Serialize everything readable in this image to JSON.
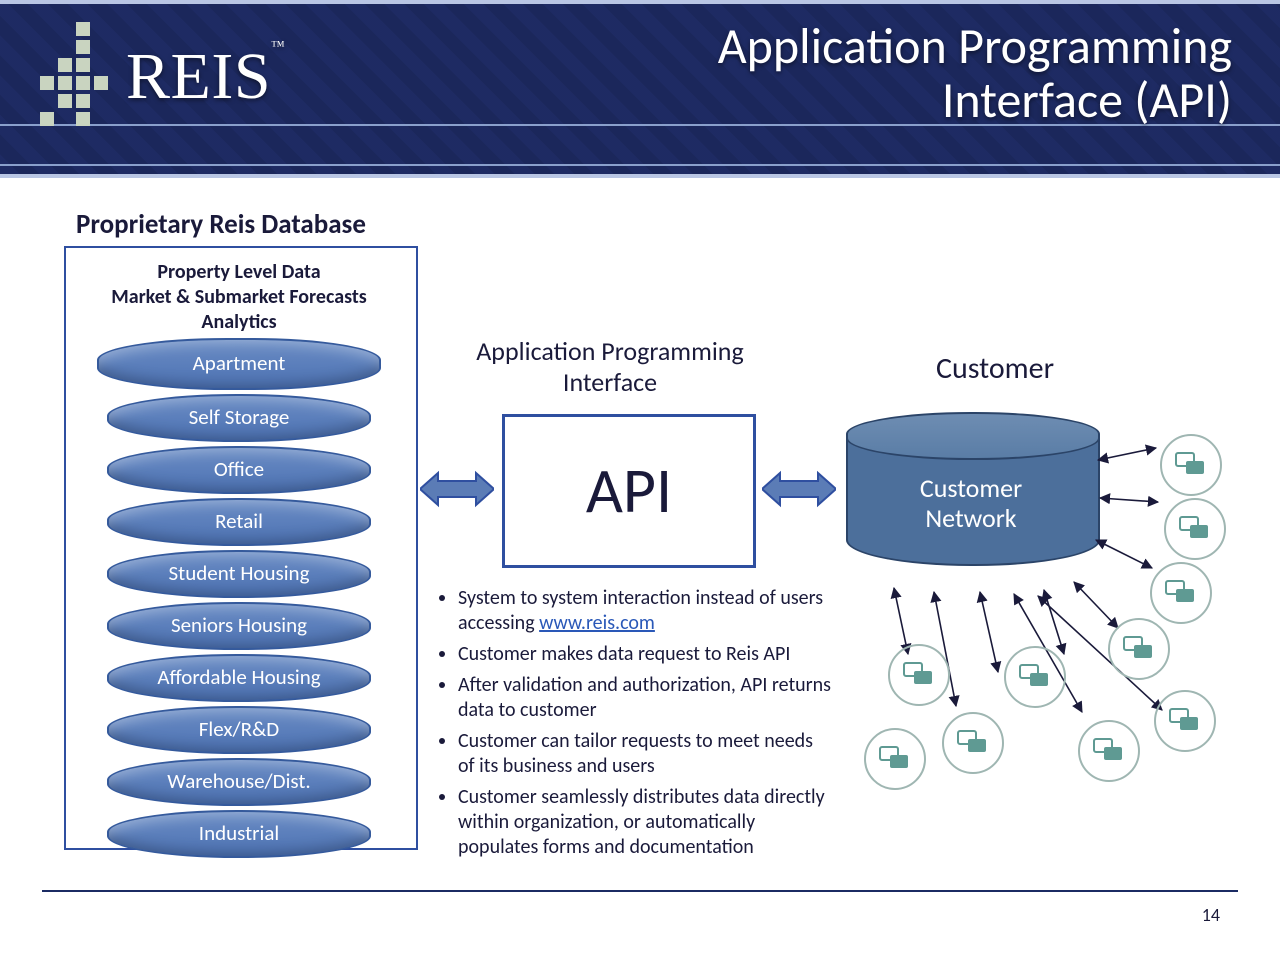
{
  "header": {
    "brand": "REIS",
    "tm": "™",
    "title_line1": "Application Programming",
    "title_line2": "Interface (API)"
  },
  "database": {
    "title": "Proprietary Reis Database",
    "head_line1": "Property Level Data",
    "head_line2": "Market & Submarket Forecasts",
    "head_line3": "Analytics",
    "items": [
      "Apartment",
      "Self Storage",
      "Office",
      "Retail",
      "Student Housing",
      "Seniors Housing",
      "Affordable Housing",
      "Flex/R&D",
      "Warehouse/Dist.",
      "Industrial"
    ]
  },
  "api": {
    "label": "Application Programming Interface",
    "box": "API"
  },
  "customer": {
    "label": "Customer",
    "network_line1": "Customer",
    "network_line2": "Network"
  },
  "bullets": {
    "b1a": "System to system interaction instead of users accessing ",
    "b1_link": "www.reis.com",
    "b2": "Customer makes data request to Reis API",
    "b3": "After validation and authorization, API returns data to customer",
    "b4": "Customer can tailor requests to meet needs of its business and users",
    "b5": "Customer seamlessly distributes data directly within organization, or automatically populates forms and documentation"
  },
  "page": "14",
  "colors": {
    "accent": "#2f4fa0",
    "cyl_fill": "#4c6f9b",
    "node_stroke": "#9fb6b2",
    "node_fill": "#5f9a93"
  }
}
